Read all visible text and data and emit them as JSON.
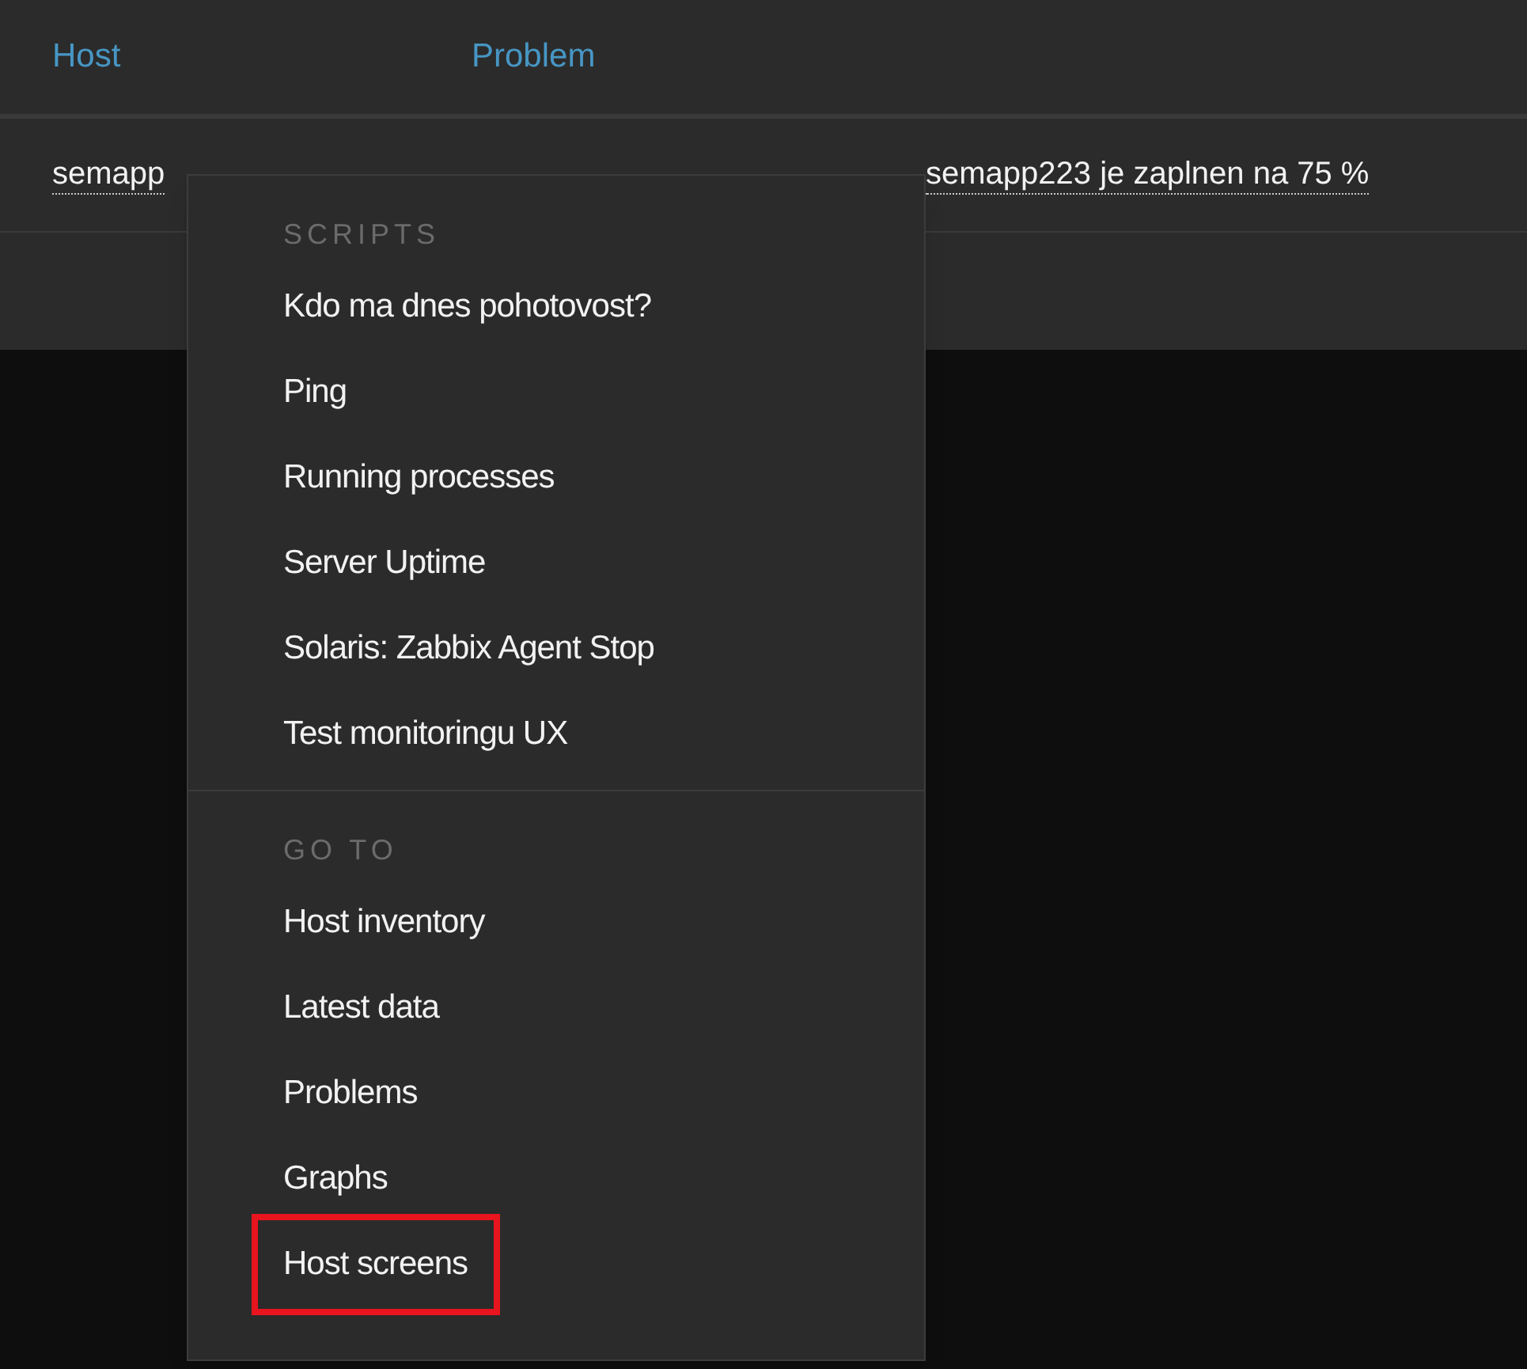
{
  "table": {
    "columns": [
      "Host",
      "Problem"
    ],
    "rows": [
      {
        "host": "semapp",
        "problem": "semapp223 je zaplnen na 75 %"
      }
    ]
  },
  "menu": {
    "sections": [
      {
        "title": "SCRIPTS",
        "items": [
          {
            "label": "Kdo ma dnes pohotovost?",
            "highlighted": false
          },
          {
            "label": "Ping",
            "highlighted": false
          },
          {
            "label": "Running processes",
            "highlighted": false
          },
          {
            "label": "Server Uptime",
            "highlighted": false
          },
          {
            "label": "Solaris: Zabbix Agent Stop",
            "highlighted": false
          },
          {
            "label": "Test monitoringu UX",
            "highlighted": false
          }
        ]
      },
      {
        "title": "GO TO",
        "items": [
          {
            "label": "Host inventory",
            "highlighted": false
          },
          {
            "label": "Latest data",
            "highlighted": false
          },
          {
            "label": "Problems",
            "highlighted": false
          },
          {
            "label": "Graphs",
            "highlighted": false
          },
          {
            "label": "Host screens",
            "highlighted": true
          }
        ]
      }
    ]
  }
}
